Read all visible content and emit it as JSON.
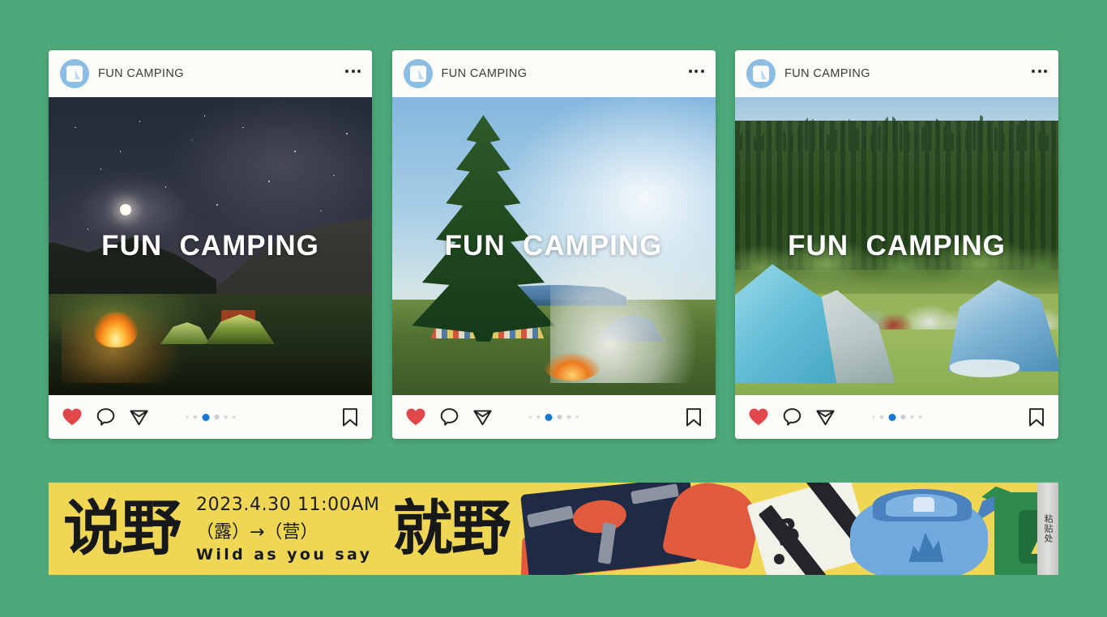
{
  "theme": {
    "background_green": "#4da97a",
    "card_bg": "#fbfbf7",
    "banner_yellow": "#efd655",
    "accent_blue": "#1877d2",
    "heart_red": "#e0464a",
    "avatar_blue": "#8cbde4"
  },
  "posts": [
    {
      "account": "FUN CAMPING",
      "avatar_icon": "tent-avatar-icon",
      "more_icon": "more-options-icon",
      "overlay_title": "FUN  CAMPING",
      "scene": "night-campfire",
      "actions": {
        "like": "like-icon",
        "comment": "comment-icon",
        "share": "share-icon",
        "save": "save-icon"
      },
      "carousel": {
        "total": 6,
        "active_index": 3
      }
    },
    {
      "account": "FUN CAMPING",
      "avatar_icon": "tent-avatar-icon",
      "more_icon": "more-options-icon",
      "overlay_title": "FUN  CAMPING",
      "scene": "pine-tree-camp",
      "actions": {
        "like": "like-icon",
        "comment": "comment-icon",
        "share": "share-icon",
        "save": "save-icon"
      },
      "carousel": {
        "total": 6,
        "active_index": 3
      }
    },
    {
      "account": "FUN CAMPING",
      "avatar_icon": "tent-avatar-icon",
      "more_icon": "more-options-icon",
      "overlay_title": "FUN  CAMPING",
      "scene": "forest-tent-field",
      "actions": {
        "like": "like-icon",
        "comment": "comment-icon",
        "share": "share-icon",
        "save": "save-icon"
      },
      "carousel": {
        "total": 6,
        "active_index": 3
      }
    }
  ],
  "banner": {
    "headline_left": "说野",
    "headline_right": "就野",
    "date": "2023.4.30 11:00AM",
    "subtitle_cn": "（露）→（营）",
    "subtitle_en": "Wild as you say",
    "side_tab_text": "粘贴处",
    "illustration": {
      "name": "camping-gear-illustration",
      "items": [
        "camp-stove",
        "playing-card-b",
        "blue-kettle",
        "green-kettle"
      ],
      "letter": "B"
    }
  }
}
